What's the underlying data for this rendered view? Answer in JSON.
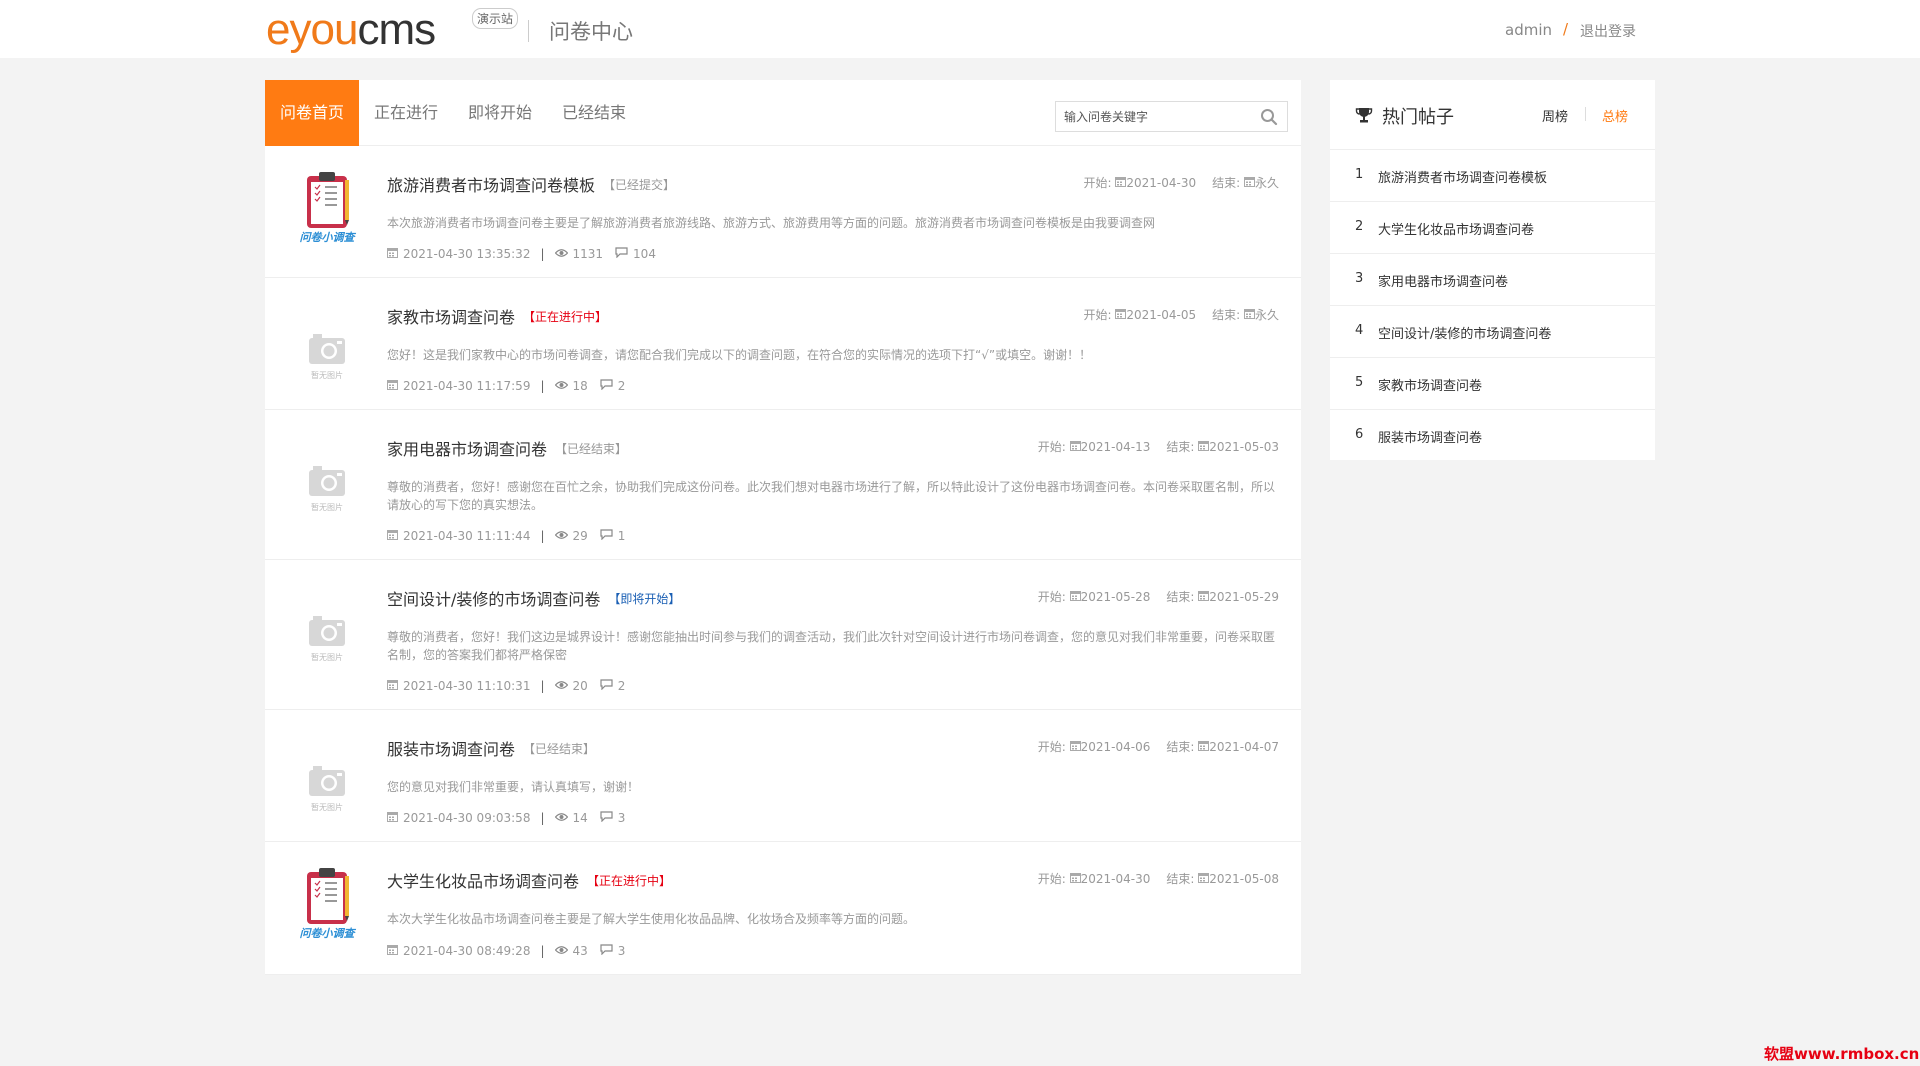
{
  "header": {
    "logo_e": "e",
    "logo_you": "you",
    "logo_cms": "cms",
    "logo_badge": "演示站",
    "center_title": "问卷中心",
    "username": "admin",
    "slash": "/",
    "logout": "退出登录"
  },
  "tabs": [
    {
      "label": "问卷首页"
    },
    {
      "label": "正在进行"
    },
    {
      "label": "即将开始"
    },
    {
      "label": "已经结束"
    }
  ],
  "search": {
    "placeholder": "输入问卷关键字"
  },
  "labels": {
    "start": "开始:",
    "end": "结束:",
    "divider": "|"
  },
  "thumb_caption": "暂无图片",
  "thumb_brand": "问卷小调查",
  "items": [
    {
      "title": "旅游消费者市场调查问卷模板",
      "status": "【已经提交】",
      "status_color": "#999999",
      "start": "2021-04-30",
      "end": "永久",
      "desc": "本次旅游消费者市场调查问卷主要是了解旅游消费者旅游线路、旅游方式、旅游费用等方面的问题。旅游消费者市场调查问卷模板是由我要调查网",
      "time": "2021-04-30 13:35:32",
      "views": "1131",
      "comments": "104",
      "thumb": "clipboard"
    },
    {
      "title": "家教市场调查问卷",
      "status": "【正在进行中】",
      "status_color": "#e60012",
      "start": "2021-04-05",
      "end": "永久",
      "desc": "您好！这是我们家教中心的市场问卷调查，请您配合我们完成以下的调查问题，在符合您的实际情况的选项下打“√”或填空。谢谢！！",
      "time": "2021-04-30 11:17:59",
      "views": "18",
      "comments": "2",
      "thumb": "camera"
    },
    {
      "title": "家用电器市场调查问卷",
      "status": "【已经结束】",
      "status_color": "#999999",
      "start": "2021-04-13",
      "end": "2021-05-03",
      "desc": "尊敬的消费者，您好！感谢您在百忙之余，协助我们完成这份问卷。此次我们想对电器市场进行了解，所以特此设计了这份电器市场调查问卷。本问卷采取匿名制，所以请放心的写下您的真实想法。",
      "time": "2021-04-30 11:11:44",
      "views": "29",
      "comments": "1",
      "thumb": "camera"
    },
    {
      "title": "空间设计/装修的市场调查问卷",
      "status": "【即将开始】",
      "status_color": "#1a5fb4",
      "start": "2021-05-28",
      "end": "2021-05-29",
      "desc": "尊敬的消费者，您好！我们这边是城界设计！感谢您能抽出时间参与我们的调查活动，我们此次针对空间设计进行市场问卷调查，您的意见对我们非常重要，问卷采取匿名制，您的答案我们都将严格保密",
      "time": "2021-04-30 11:10:31",
      "views": "20",
      "comments": "2",
      "thumb": "camera"
    },
    {
      "title": "服装市场调查问卷",
      "status": "【已经结束】",
      "status_color": "#999999",
      "start": "2021-04-06",
      "end": "2021-04-07",
      "desc": "您的意见对我们非常重要，请认真填写，谢谢！",
      "time": "2021-04-30 09:03:58",
      "views": "14",
      "comments": "3",
      "thumb": "camera"
    },
    {
      "title": "大学生化妆品市场调查问卷",
      "status": "【正在进行中】",
      "status_color": "#e60012",
      "start": "2021-04-30",
      "end": "2021-05-08",
      "desc": "本次大学生化妆品市场调查问卷主要是了解大学生使用化妆品品牌、化妆场合及频率等方面的问题。",
      "time": "2021-04-30 08:49:28",
      "views": "43",
      "comments": "3",
      "thumb": "clipboard"
    }
  ],
  "sidebar": {
    "title": "热门帖子",
    "tab_week": "周榜",
    "tab_all": "总榜",
    "items": [
      {
        "num": "1",
        "label": "旅游消费者市场调查问卷模板"
      },
      {
        "num": "2",
        "label": "大学生化妆品市场调查问卷"
      },
      {
        "num": "3",
        "label": "家用电器市场调查问卷"
      },
      {
        "num": "4",
        "label": "空间设计/装修的市场调查问卷"
      },
      {
        "num": "5",
        "label": "家教市场调查问卷"
      },
      {
        "num": "6",
        "label": "服装市场调查问卷"
      }
    ]
  },
  "watermark": "软盟www.rmbox.cn",
  "colors": {
    "accent": "#ff7b12",
    "background": "#f3f3f3"
  }
}
